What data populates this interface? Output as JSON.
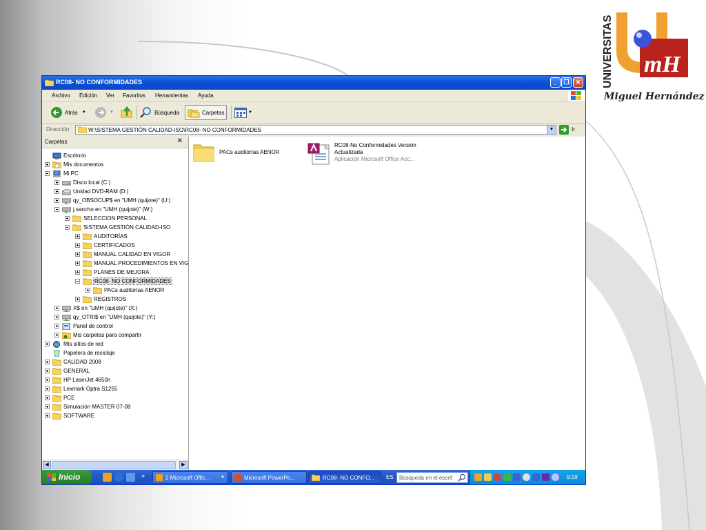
{
  "logo": {
    "vertical_text": "UNIVERSITAS",
    "monogram": "mH",
    "caption": "Miguel Hernández"
  },
  "window": {
    "title": "RC08- NO CONFORMIDADES",
    "controls": [
      "_",
      "❐",
      "✕"
    ]
  },
  "menu": [
    "Archivo",
    "Edición",
    "Ver",
    "Favoritos",
    "Herramientas",
    "Ayuda"
  ],
  "toolbar": {
    "back": "Atrás",
    "search": "Búsqueda",
    "folders": "Carpetas"
  },
  "address": {
    "label": "Dirección",
    "value": "W:\\SISTEMA GESTIÓN CALIDAD-ISO\\RC08- NO CONFORMIDADES",
    "go": "Ir"
  },
  "folders_pane": {
    "title": "Carpetas",
    "close": "✕",
    "tree": [
      "Escritorio",
      "Mis documentos",
      "Mi PC",
      "Disco local (C:)",
      "Unidad DVD-RAM (D:)",
      "qy_OBSOCUP$ en \"UMH (quijote)\" (U:)",
      "j.sancho en \"UMH (quijote)\" (W:)",
      "SELECCION PERSONAL",
      "SISTEMA GESTIÓN CALIDAD-ISO",
      "AUDITORÍAS",
      "CERTIFICADOS",
      "MANUAL CALIDAD EN VIGOR",
      "MANUAL PROCEDIMIENTOS EN VIGOR",
      "PLANES DE MEJORA",
      "RC08- NO CONFORMIDADES",
      "PACs auditorías AENOR",
      "REGISTROS",
      "X$ en \"UMH (quijote)\" (X:)",
      "qy_OTRI$ en \"UMH (quijote)\" (Y:)",
      "Panel de control",
      "Mis carpetas para compartir",
      "Mis sitios de red",
      "Papelera de reciclaje",
      "CALIDAD 2008",
      "GENERAL",
      "HP LaserJet 4650n",
      "Lexmark Optra S1255",
      "PCE",
      "Simulación MASTER 07-08",
      "SOFTWARE"
    ]
  },
  "files": {
    "folder": {
      "name": "PACs auditorías AENOR"
    },
    "access": {
      "name_line1": "RC08-No Conformidades Versión",
      "name_line2": "Actualizada",
      "type": "Aplicación Microsoft Office Acc..."
    }
  },
  "taskbar": {
    "start": "Inicio",
    "chevron": "»",
    "tasks": [
      "2 Microsoft Offic...",
      "Microsoft PowerPo...",
      "RC08- NO CONFO..."
    ],
    "lang": "ES",
    "search_placeholder": "Búsqueda en el escrit",
    "clock": "9:19"
  },
  "colors": {
    "xp_blue": "#0a4fd6",
    "start_green": "#2f8a2f",
    "tray_blue": "#0c8ad6",
    "folder_yellow": "#f4d35e"
  }
}
